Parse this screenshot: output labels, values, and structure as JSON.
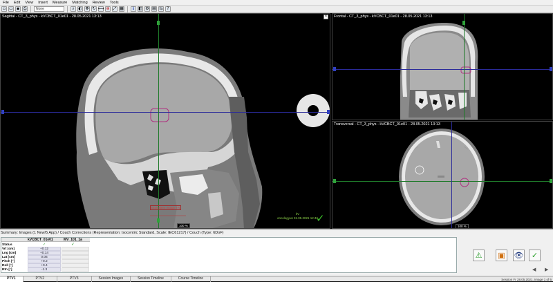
{
  "menu": [
    "File",
    "Edit",
    "View",
    "Insert",
    "Measure",
    "Matching",
    "Review",
    "Tools"
  ],
  "toolbar": {
    "combo_value": "None",
    "icons": [
      "new-icon",
      "open-icon",
      "save-icon",
      "print-icon",
      "zoom-icon",
      "window-level-icon",
      "pan-icon",
      "rotate-icon",
      "measure-icon",
      "crosshair-icon",
      "fit-icon",
      "grid-icon",
      "info-icon",
      "overlay-icon",
      "settings-icon",
      "layout-icon",
      "compare-icon",
      "help-icon"
    ]
  },
  "views": {
    "sagittal": {
      "title": "Sagittal - CT_3_phys - kVCBCT_01e01 - 28.05.2021 13:13",
      "zoom": "100 %"
    },
    "frontal": {
      "title": "Frontal - CT_3_phys - kVCBCT_01e01 - 28.05.2021 13:13"
    },
    "transversal": {
      "title": "Transversal - CT_3_phys - kVCBCT_01e01 - 28.05.2021 13:13",
      "zoom": "100 %"
    },
    "close_label": "×"
  },
  "approval": {
    "line1": "kV",
    "line2": "oncologyus 31.05.2021 12:46"
  },
  "structure_label": "Brainstem Image TR",
  "summary": {
    "title": "Summary: Images (1 New/5 App) / Couch Corrections (Representation: Isocentric Standard, Scale: IEC61217) / Couch (Type: 6DoF)",
    "columns": [
      "kVCBCT_01e01",
      "MV_101_1a"
    ],
    "rows": [
      {
        "label": "Status",
        "value": "✓"
      },
      {
        "label": "Vrt [cm]",
        "value": "+0.12"
      },
      {
        "label": "Lng [cm]",
        "value": "+0.14"
      },
      {
        "label": "Lat [cm]",
        "value": "0.06"
      },
      {
        "label": "Pitch [°]",
        "value": "+0.2"
      },
      {
        "label": "Roll [°]",
        "value": "+0.4"
      },
      {
        "label": "Rtn [°]",
        "value": "-1.3"
      }
    ]
  },
  "actions": [
    "warning-icon",
    "document-icon",
    "view-eye-icon",
    "approve-check-icon"
  ],
  "tabs": [
    "PTV1",
    "PTV2",
    "PTV3",
    "Session Images",
    "Session Timeline",
    "Course Timeline"
  ],
  "session_info": "Session Fr 28.05.2021, Image 1 of 6",
  "colors": {
    "check": "#3bbf2a",
    "structure": "#b03080",
    "accent_blue": "#2a2a9a",
    "accent_green": "#1f7a2a"
  }
}
